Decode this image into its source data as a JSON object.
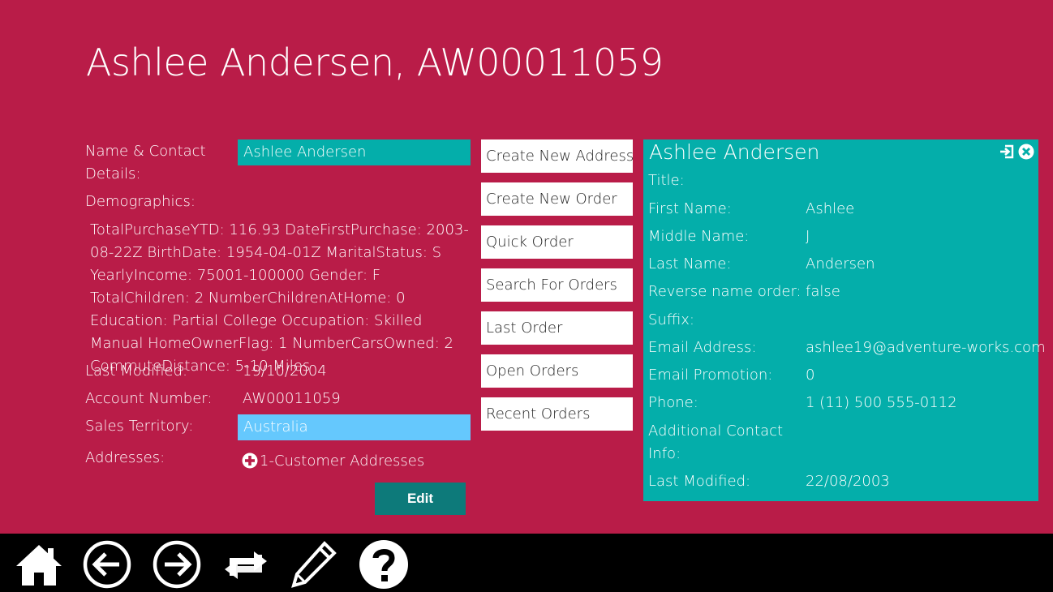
{
  "header": {
    "title": "Ashlee Andersen, AW00011059"
  },
  "details": {
    "name_contact_label": "Name & Contact Details:",
    "name_contact_value": "Ashlee Andersen",
    "demographics_label": "Demographics:",
    "demographics_text": "TotalPurchaseYTD: 116.93 DateFirstPurchase: 2003-08-22Z BirthDate: 1954-04-01Z MaritalStatus: S YearlyIncome: 75001-100000 Gender: F TotalChildren: 2 NumberChildrenAtHome: 0 Education: Partial College Occupation: Skilled Manual HomeOwnerFlag: 1 NumberCarsOwned: 2 CommuteDistance: 5-10 Miles",
    "last_modified_label": "Last Modified:",
    "last_modified_value": "19/10/2004",
    "account_number_label": "Account Number:",
    "account_number_value": "AW00011059",
    "sales_territory_label": "Sales Territory:",
    "sales_territory_value": "Australia",
    "addresses_label": "Addresses:",
    "addresses_link": "1-Customer Addresses",
    "edit_label": "Edit"
  },
  "actions": [
    "Create New Address",
    "Create New Order",
    "Quick Order",
    "Search For Orders",
    "Last Order",
    "Open Orders",
    "Recent Orders"
  ],
  "panel": {
    "title": "Ashlee Andersen",
    "fields": [
      {
        "label": "Title:",
        "value": ""
      },
      {
        "label": "First Name:",
        "value": "Ashlee"
      },
      {
        "label": "Middle Name:",
        "value": "J"
      },
      {
        "label": "Last Name:",
        "value": "Andersen"
      },
      {
        "label": "Reverse name order:",
        "value": "false"
      },
      {
        "label": "Suffix:",
        "value": ""
      },
      {
        "label": "Email Address:",
        "value": "ashlee19@adventure-works.com"
      },
      {
        "label": "Email Promotion:",
        "value": "0"
      },
      {
        "label": "Phone:",
        "value": "1 (11) 500 555-0112"
      },
      {
        "label": "Additional Contact Info:",
        "value": ""
      },
      {
        "label": "Last Modified:",
        "value": "22/08/2003"
      }
    ]
  },
  "toolbar": {
    "icons": [
      "home-icon",
      "back-icon",
      "forward-icon",
      "swap-icon",
      "edit-icon",
      "help-icon"
    ]
  },
  "colors": {
    "background": "#b91c48",
    "teal": "#04aeaa",
    "territory": "#65c8fd",
    "edit_button": "#0d7a7a",
    "bottom_bar": "#000000"
  }
}
